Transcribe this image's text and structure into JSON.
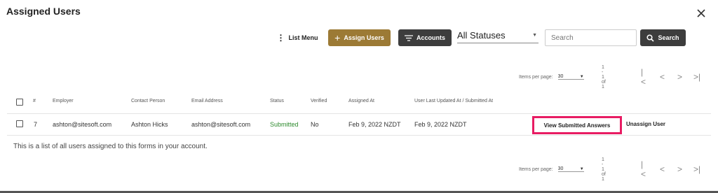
{
  "dialog": {
    "title": "Assigned Users"
  },
  "toolbar": {
    "list_menu_label": "List Menu",
    "assign_users_label": "Assign Users",
    "accounts_label": "Accounts",
    "status_filter_value": "All Statuses",
    "search_placeholder": "Search",
    "search_button_label": "Search"
  },
  "paginator_top": {
    "items_per_page_label": "Items per page:",
    "page_size": "30",
    "range": "1 - 1 of 1"
  },
  "paginator_bottom": {
    "items_per_page_label": "Items per page:",
    "page_size": "30",
    "range": "1 - 1 of 1"
  },
  "table": {
    "headers": {
      "number": "#",
      "employer": "Employer",
      "contact_person": "Contact Person",
      "email_address": "Email Address",
      "status": "Status",
      "verified": "Verified",
      "assigned_at": "Assigned At",
      "last_updated": "User Last Updated At / Submitted At"
    },
    "rows": [
      {
        "number": "7",
        "employer": "ashton@sitesoft.com",
        "contact_person": "Ashton Hicks",
        "email_address": "ashton@sitesoft.com",
        "status": "Submitted",
        "verified": "No",
        "assigned_at": "Feb 9, 2022 NZDT",
        "last_updated": "Feb 9, 2022 NZDT",
        "view_label": "View Submitted Answers",
        "unassign_label": "Unassign User"
      }
    ]
  },
  "info_text": "This is a list of all users assigned to this forms in your account.",
  "colors": {
    "assign_button": "#9c7a35",
    "dark_button": "#3d3d3d",
    "highlight": "#e81c63",
    "status_submitted": "#2e8b2e"
  }
}
